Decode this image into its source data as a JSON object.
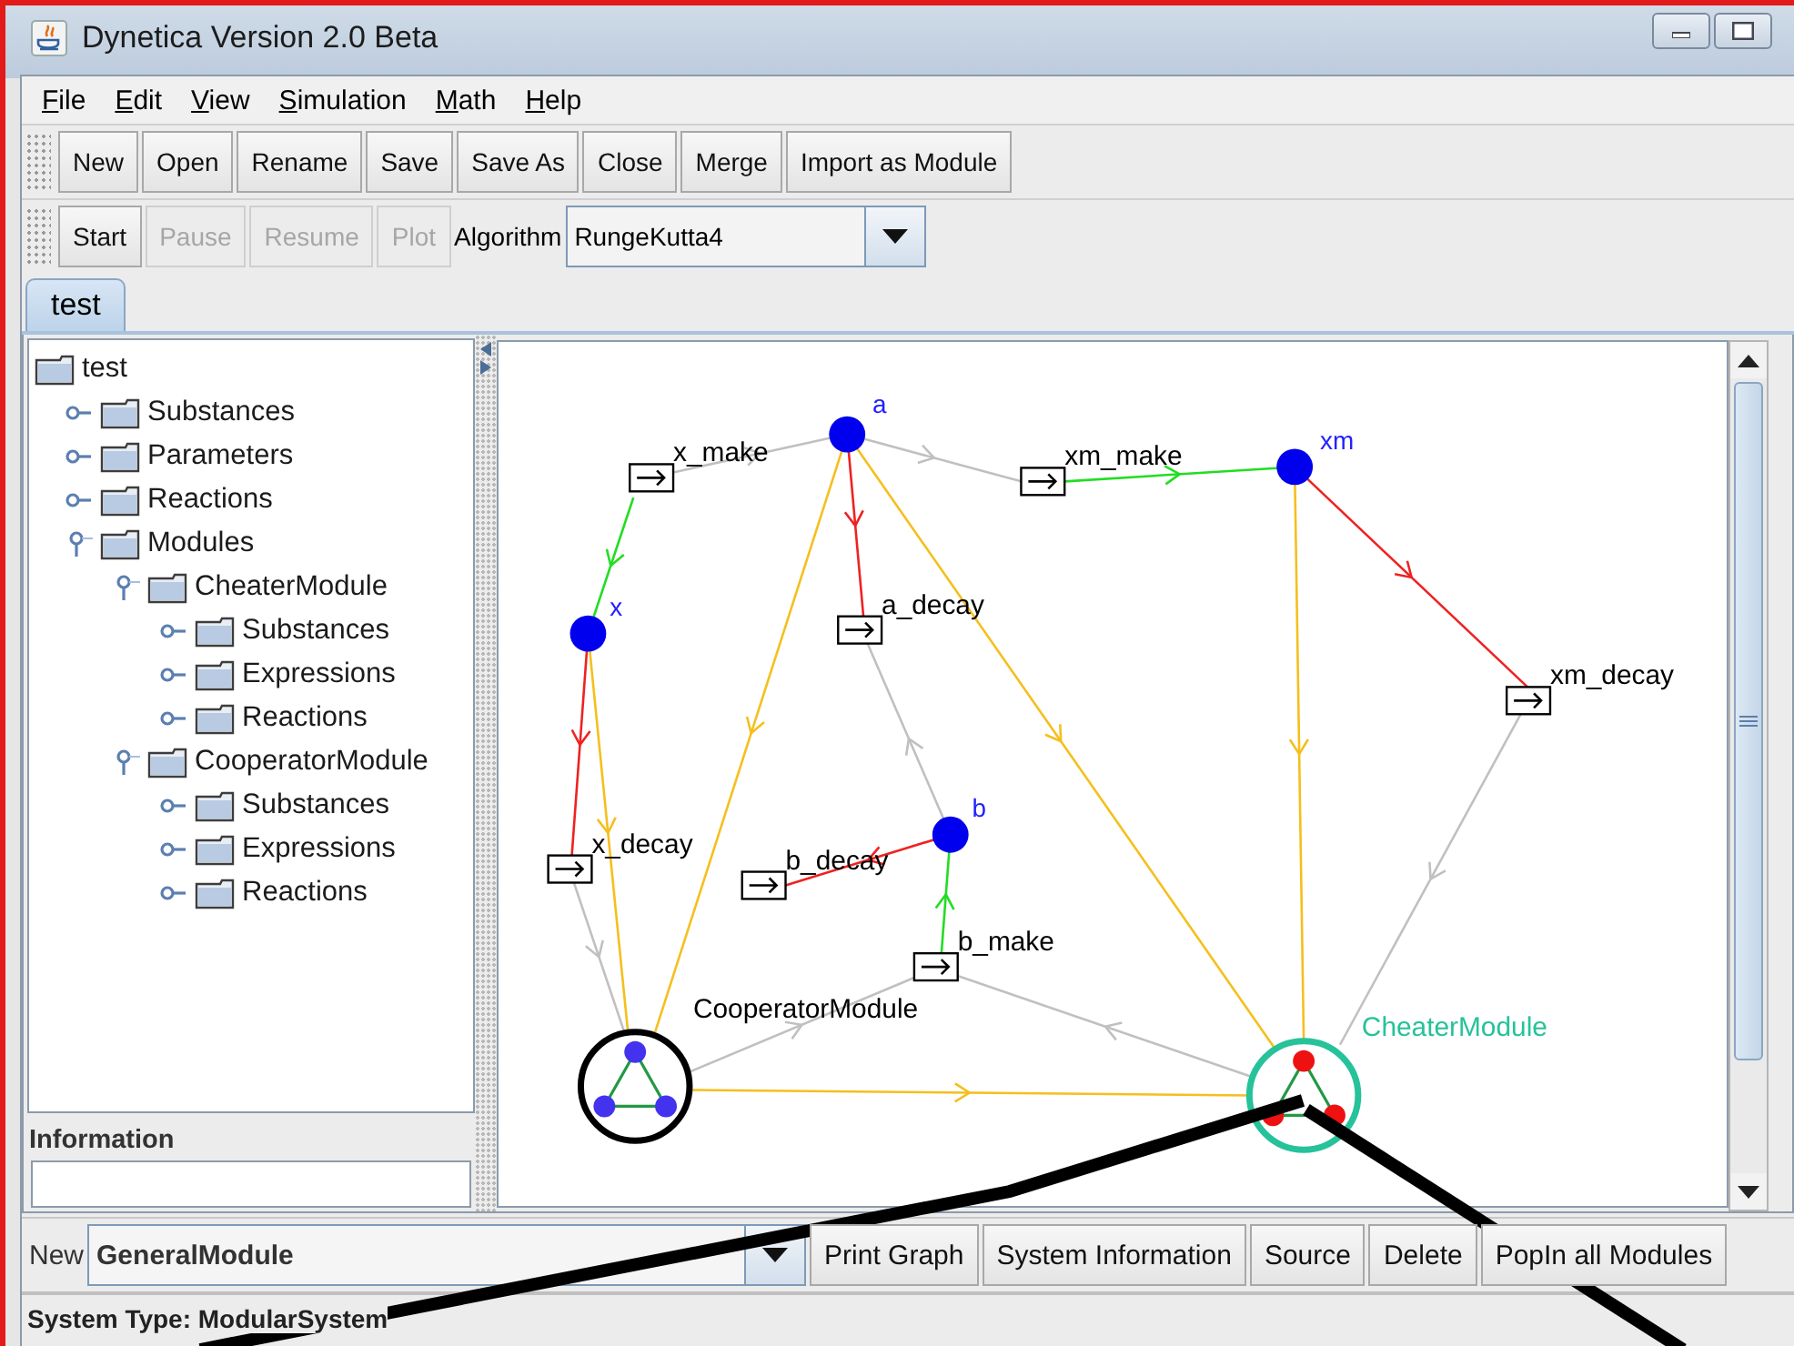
{
  "window": {
    "title": "Dynetica Version 2.0 Beta"
  },
  "menu": [
    "File",
    "Edit",
    "View",
    "Simulation",
    "Math",
    "Help"
  ],
  "file_toolbar": [
    "New",
    "Open",
    "Rename",
    "Save",
    "Save As",
    "Close",
    "Merge",
    "Import as Module"
  ],
  "sim_toolbar": {
    "buttons": [
      {
        "label": "Start",
        "disabled": false
      },
      {
        "label": "Pause",
        "disabled": true
      },
      {
        "label": "Resume",
        "disabled": true
      },
      {
        "label": "Plot",
        "disabled": true
      }
    ],
    "algorithm_label": "Algorithm",
    "algorithm": "RungeKutta4"
  },
  "tabs": [
    {
      "label": "test",
      "selected": true
    }
  ],
  "tree": {
    "label": "test",
    "children": [
      {
        "label": "Substances",
        "expanded": false
      },
      {
        "label": "Parameters",
        "expanded": false
      },
      {
        "label": "Reactions",
        "expanded": false
      },
      {
        "label": "Modules",
        "expanded": true,
        "children": [
          {
            "label": "CheaterModule",
            "expanded": true,
            "children": [
              {
                "label": "Substances",
                "expanded": false
              },
              {
                "label": "Expressions",
                "expanded": false
              },
              {
                "label": "Reactions",
                "expanded": false
              }
            ]
          },
          {
            "label": "CooperatorModule",
            "expanded": true,
            "children": [
              {
                "label": "Substances",
                "expanded": false
              },
              {
                "label": "Expressions",
                "expanded": false
              },
              {
                "label": "Reactions",
                "expanded": false
              }
            ]
          }
        ]
      }
    ]
  },
  "information": {
    "title": "Information"
  },
  "graph": {
    "substances": [
      {
        "label": "a"
      },
      {
        "label": "x"
      },
      {
        "label": "xm"
      },
      {
        "label": "b"
      }
    ],
    "reactions": [
      {
        "label": "x_make"
      },
      {
        "label": "xm_make"
      },
      {
        "label": "a_decay"
      },
      {
        "label": "xm_decay"
      },
      {
        "label": "x_decay"
      },
      {
        "label": "b_decay"
      },
      {
        "label": "b_make"
      }
    ],
    "modules": [
      {
        "label": "CooperatorModule",
        "kind": "cooperator",
        "color": "#000000"
      },
      {
        "label": "CheaterModule",
        "kind": "cheater",
        "color": "#26c29a"
      }
    ],
    "edges": [
      {
        "color": "#c0c0c0"
      },
      {
        "color": "#c0c0c0"
      },
      {
        "color": "#22dd22"
      },
      {
        "color": "#22dd22"
      },
      {
        "color": "#ee2222"
      },
      {
        "color": "#ee2222"
      },
      {
        "color": "#ee2222"
      },
      {
        "color": "#ee2222"
      },
      {
        "color": "#22dd22"
      },
      {
        "color": "#c0c0c0"
      },
      {
        "color": "#c0c0c0"
      },
      {
        "color": "#c0c0c0"
      },
      {
        "color": "#c0c0c0"
      },
      {
        "color": "#c0c0c0"
      },
      {
        "color": "#f5bf1d"
      },
      {
        "color": "#f5bf1d"
      },
      {
        "color": "#f5bf1d"
      },
      {
        "color": "#f5bf1d"
      },
      {
        "color": "#f5bf1d"
      }
    ]
  },
  "bottom_bar": {
    "new_label": "New",
    "module_type": "GeneralModule",
    "buttons": [
      "Print Graph",
      "System Information",
      "Source",
      "Delete",
      "PopIn all Modules"
    ]
  },
  "status_bar": {
    "text": "System Type: ModularSystem"
  }
}
